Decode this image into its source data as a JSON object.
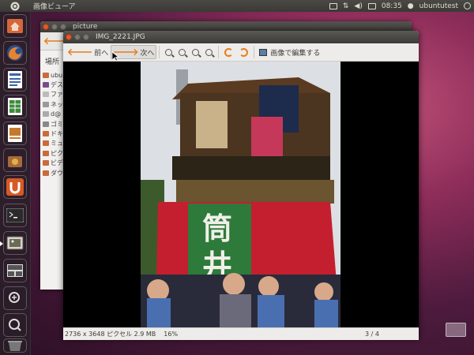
{
  "panel": {
    "app_title": "画像ビューア",
    "clock": "08:35",
    "user": "ubuntutest"
  },
  "launcher": {
    "items": [
      {
        "name": "home-folder",
        "color": "#d5673a"
      },
      {
        "name": "firefox",
        "color": "#e0822b"
      },
      {
        "name": "writer",
        "color": "#3a66a6"
      },
      {
        "name": "calc",
        "color": "#3e8a3c"
      },
      {
        "name": "impress",
        "color": "#c5792c"
      },
      {
        "name": "software-center",
        "color": "#a66b3a"
      },
      {
        "name": "ubuntu-one",
        "color": "#d75a25"
      },
      {
        "name": "terminal",
        "color": "#2f2f2f"
      },
      {
        "name": "image-viewer",
        "color": "#6b6b58"
      },
      {
        "name": "workspaces",
        "color": "#4a4a4a"
      },
      {
        "name": "zoom-in",
        "color": "#3e3e3e"
      },
      {
        "name": "magnifier",
        "color": "#3e3e3e"
      },
      {
        "name": "trash",
        "color": "#2f2f2f"
      }
    ]
  },
  "file_manager": {
    "title": "picture",
    "back_label": "戻",
    "places_title": "場所",
    "places": [
      "ubu",
      "デス",
      "ファ",
      "ネッ",
      "d@",
      "ゴミ",
      "ドキ",
      "ミュ",
      "ピク",
      "ビデ",
      "ダウ"
    ]
  },
  "viewer": {
    "title": "IMG_2221.JPG",
    "toolbar": {
      "prev": "前へ",
      "next": "次へ",
      "edit": "画像で編集する"
    },
    "status": {
      "info": "2736 x 3648 ピクセル  2.9 MB",
      "zoom": "16%",
      "count": "3 / 4"
    }
  },
  "colors": {
    "accent": "#e67e22",
    "panel": "#3c3b37",
    "close": "#e25a2c"
  }
}
